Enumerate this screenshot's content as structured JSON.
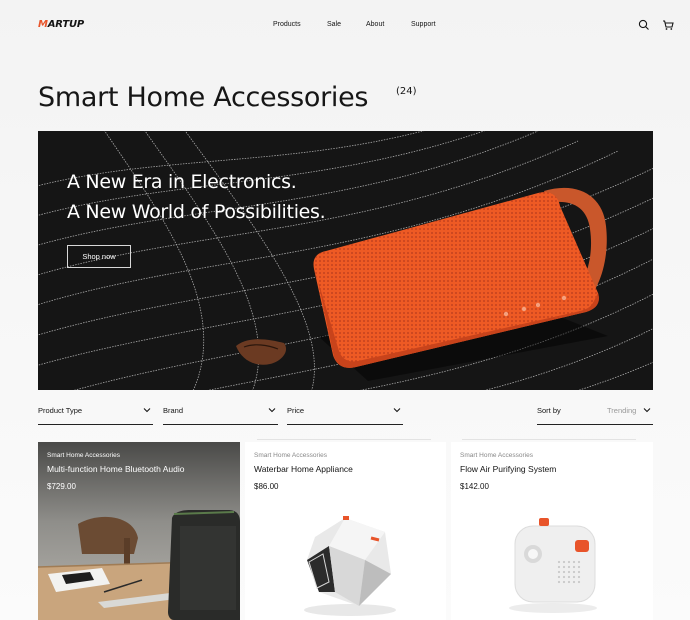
{
  "brand": {
    "logo_first": "M",
    "logo_rest": "ARTUP"
  },
  "nav": {
    "items": [
      "Products",
      "Sale",
      "About",
      "Support"
    ]
  },
  "header_icons": [
    "search-icon",
    "cart-icon"
  ],
  "page": {
    "title": "Smart Home Accessories",
    "count": "(24)"
  },
  "hero": {
    "headline_1": "A New Era in Electronics.",
    "headline_2": "A New World of Possibilities.",
    "cta": "Shop now"
  },
  "filters": [
    {
      "label": "Product Type"
    },
    {
      "label": "Brand"
    },
    {
      "label": "Price"
    }
  ],
  "sort": {
    "label": "Sort by",
    "value": "Trending"
  },
  "products": [
    {
      "category": "Smart Home Accessories",
      "name": "Multi-function Home Bluetooth Audio",
      "price": "$729.00"
    },
    {
      "category": "Smart Home Accessories",
      "name": "Waterbar Home Appliance",
      "price": "$86.00"
    },
    {
      "category": "Smart Home Accessories",
      "name": "Flow Air Purifying System",
      "price": "$142.00"
    }
  ],
  "colors": {
    "accent": "#e8542a",
    "hero_bg": "#111111",
    "text": "#151515"
  }
}
